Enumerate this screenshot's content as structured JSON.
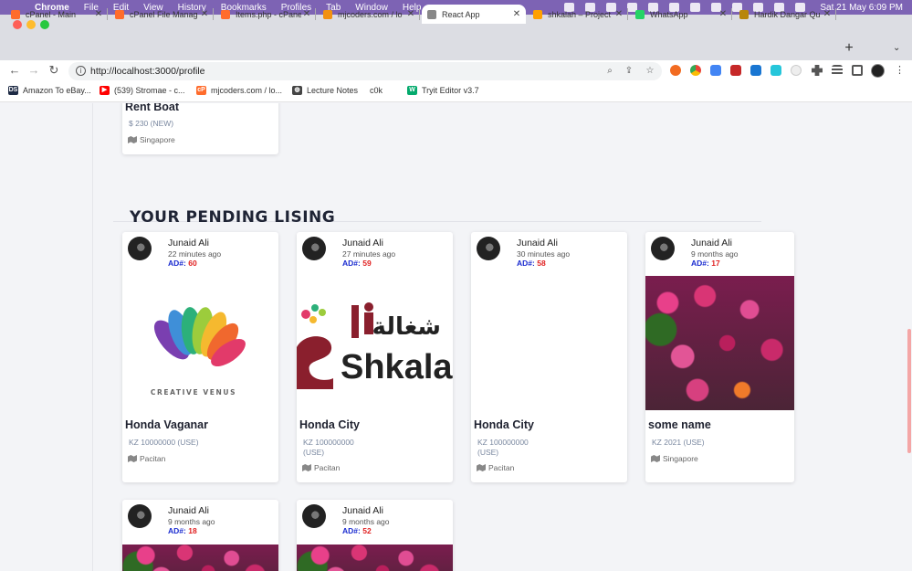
{
  "menubar": {
    "app": "Chrome",
    "items": [
      "File",
      "Edit",
      "View",
      "History",
      "Bookmarks",
      "Profiles",
      "Tab",
      "Window",
      "Help"
    ],
    "clock": "Sat 21 May  6:09 PM"
  },
  "tabs": [
    {
      "label": "cPanel - Main",
      "icon": "cpanel-icon",
      "color": "#ff6c2c"
    },
    {
      "label": "cPanel File Manag",
      "icon": "cpanel-icon",
      "color": "#ff6c2c"
    },
    {
      "label": "Items.php - cPane",
      "icon": "cpanel-icon",
      "color": "#ff6c2c"
    },
    {
      "label": "mjcoders.com / lo",
      "icon": "phpmyadmin-icon",
      "color": "#f29111"
    },
    {
      "label": "React App",
      "icon": "react-icon",
      "color": "#888888",
      "active": true
    },
    {
      "label": "shkalah – Project",
      "icon": "firebase-icon",
      "color": "#ffa000"
    },
    {
      "label": "WhatsApp",
      "icon": "whatsapp-icon",
      "color": "#25d366"
    },
    {
      "label": "Hardik Dangar Qu",
      "icon": "page-icon",
      "color": "#b8860b"
    }
  ],
  "toolbar": {
    "url": "http://localhost:3000/profile"
  },
  "bookmarks": [
    {
      "label": "Amazon To eBay...",
      "icon": "ds-icon",
      "glyph": "DS",
      "color": "#1d2a44"
    },
    {
      "label": "(539) Stromae - c...",
      "icon": "youtube-icon",
      "glyph": "▶",
      "color": "#ff0000"
    },
    {
      "label": "mjcoders.com / lo...",
      "icon": "cpanel-icon",
      "glyph": "cP",
      "color": "#ff6c2c"
    },
    {
      "label": "Lecture Notes",
      "icon": "globe-icon",
      "glyph": "◍",
      "color": "#444444"
    },
    {
      "label": "c0k",
      "icon": "blank-icon",
      "glyph": "",
      "color": "#ffffff"
    },
    {
      "label": "Tryit Editor v3.7",
      "icon": "w3-icon",
      "glyph": "W",
      "color": "#04aa6d"
    }
  ],
  "top_card": {
    "title": "Rent Boat",
    "price": "$ 230 (NEW)",
    "location": "Singapore"
  },
  "section": {
    "heading": "YOUR PENDING LISING"
  },
  "listings": [
    {
      "author": "Junaid Ali",
      "time": "22 minutes ago",
      "ad_label": "AD#:",
      "ad_number": "60",
      "title": "Honda Vaganar",
      "price": "KZ 10000000 (USE)",
      "location": "Pacitan",
      "image": "creative-venus-logo"
    },
    {
      "author": "Junaid Ali",
      "time": "27 minutes ago",
      "ad_label": "AD#:",
      "ad_number": "59",
      "title": "Honda City",
      "price": "KZ 100000000 (USE)",
      "location": "Pacitan",
      "image": "shkalah-logo"
    },
    {
      "author": "Junaid Ali",
      "time": "30 minutes ago",
      "ad_label": "AD#:",
      "ad_number": "58",
      "title": "Honda City",
      "price": "KZ 100000000 (USE)",
      "location": "Pacitan",
      "image": "blank"
    },
    {
      "author": "Junaid Ali",
      "time": "9 months ago",
      "ad_label": "AD#:",
      "ad_number": "17",
      "title": "some name",
      "price": "KZ 2021 (USE)",
      "location": "Singapore",
      "image": "flowers-photo"
    },
    {
      "author": "Junaid Ali",
      "time": "9 months ago",
      "ad_label": "AD#:",
      "ad_number": "18",
      "image": "flowers-photo"
    },
    {
      "author": "Junaid Ali",
      "time": "9 months ago",
      "ad_label": "AD#:",
      "ad_number": "52",
      "image": "flowers-photo"
    }
  ],
  "images": {
    "venus_text": "CREATIVE VENUS",
    "shkalah_text": "Shkalal",
    "shkalah_arabic": "شغالة"
  }
}
